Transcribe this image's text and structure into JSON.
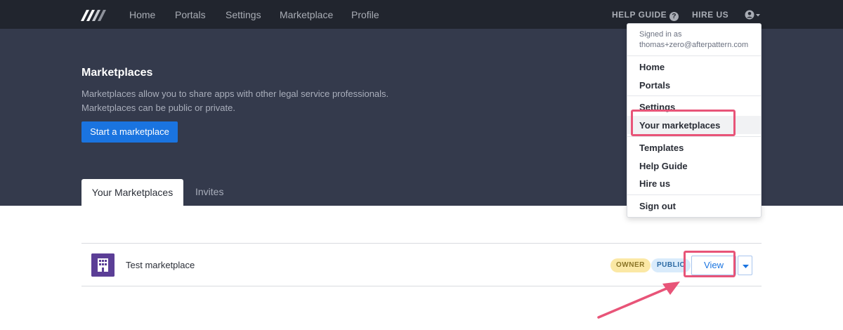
{
  "topnav": {
    "logo": "afterpattern-logo",
    "links": [
      "Home",
      "Portals",
      "Settings",
      "Marketplace",
      "Profile"
    ],
    "help_label": "HELP GUIDE",
    "help_icon": "question-circle-icon",
    "hire_label": "HIRE US",
    "user_icon": "user-circle-icon"
  },
  "hero": {
    "title": "Marketplaces",
    "description_line1": "Marketplaces allow you to share apps with other legal service professionals.",
    "description_line2": "Marketplaces can be public or private.",
    "start_button": "Start a marketplace"
  },
  "tabs": {
    "active": "Your Marketplaces",
    "invites": "Invites"
  },
  "marketplace_row": {
    "name": "Test marketplace",
    "icon": "building-icon",
    "badge_owner": "OWNER",
    "badge_public": "PUBLIC",
    "view_button": "View",
    "caret_icon": "caret-down-icon"
  },
  "dropdown": {
    "signed_in_label": "Signed in as",
    "email": "thomas+zero@afterpattern.com",
    "items": [
      "Home",
      "Portals",
      "Settings",
      "Your marketplaces",
      "Templates",
      "Help Guide",
      "Hire us",
      "Sign out"
    ]
  },
  "colors": {
    "nav_bg": "#21252e",
    "hero_bg": "#343a4c",
    "primary": "#1a74e0",
    "highlight": "#e85478",
    "marketplace_icon_bg": "#5b3e96"
  }
}
